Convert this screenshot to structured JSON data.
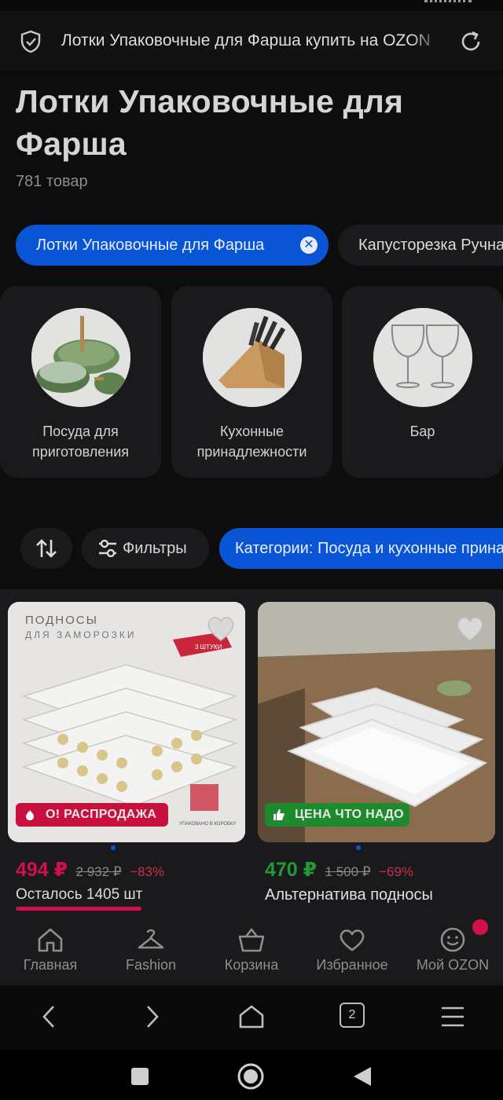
{
  "url_bar": {
    "title": "Лотки Упаковочные для Фарша купить на OZON",
    "shield_icon": "shield-check-icon",
    "reload_icon": "reload-icon"
  },
  "page": {
    "heading": "Лотки Упаковочные для Фарша",
    "count": "781 товар"
  },
  "chips": [
    {
      "label": "Лотки Упаковочные для Фарша",
      "active": true
    },
    {
      "label": "Капусторезка Ручная",
      "active": false
    }
  ],
  "categories": [
    {
      "label": "Посуда для приготовления"
    },
    {
      "label": "Кухонные принадлежности"
    },
    {
      "label": "Бар"
    }
  ],
  "filters": {
    "sort_icon": "sort-arrows-icon",
    "filters_label": "Фильтры",
    "category_chip": "Категории: Посуда и кухонные принадлежности"
  },
  "products": [
    {
      "image_text_1": "ПОДНОСЫ",
      "image_text_2": "ДЛЯ ЗАМОРОЗКИ",
      "image_tag": "3 ШТУКИ",
      "image_box_text": "УПАКОВАНО В КОРОБКУ",
      "badge": "О! РАСПРОДАЖА",
      "badge_color": "#c8103e",
      "price": "494 ₽",
      "price_color": "#d0104a",
      "old_price": "2 932 ₽",
      "discount": "−83%",
      "stock_text": "Осталось 1405 шт"
    },
    {
      "badge": "ЦЕНА ЧТО НАДО",
      "badge_color": "#1e8a2e",
      "price": "470 ₽",
      "price_color": "#1f9a35",
      "old_price": "1 500 ₽",
      "discount": "−69%",
      "title": "Альтернатива подносы"
    }
  ],
  "bottom_nav": [
    {
      "label": "Главная",
      "icon": "home-icon"
    },
    {
      "label": "Fashion",
      "icon": "hanger-icon"
    },
    {
      "label": "Корзина",
      "icon": "cart-icon"
    },
    {
      "label": "Избранное",
      "icon": "heart-icon"
    },
    {
      "label": "Мой OZON",
      "icon": "profile-face-icon"
    }
  ],
  "browser_nav": {
    "tabs_count": "2"
  },
  "colors": {
    "accent": "#0a55d6",
    "sale": "#d0104a"
  }
}
